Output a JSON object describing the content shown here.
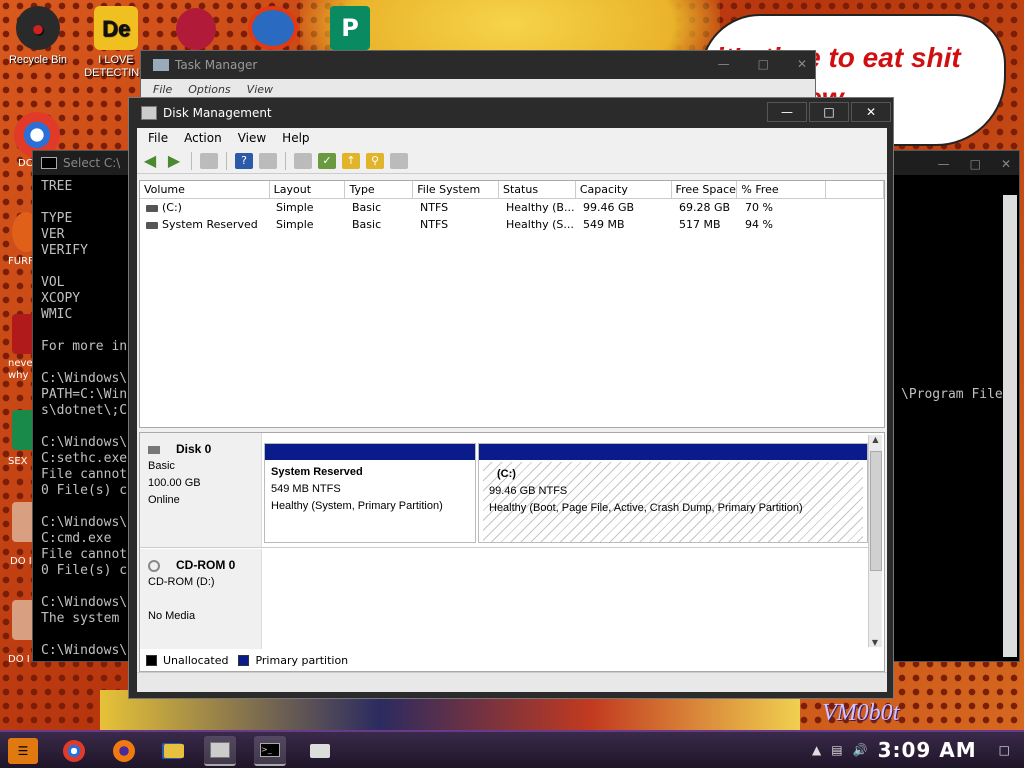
{
  "wallpaper": {
    "speech_bubble": "it's time to eat shit and chew",
    "tag": "VM0b0t"
  },
  "desktop": {
    "icons": [
      {
        "label": "Recycle Bin"
      },
      {
        "label": "I LOVE DETECTING"
      }
    ],
    "side_labels": [
      "DC",
      "FURF",
      "neve why",
      "SEX",
      "DO I",
      "DO I"
    ]
  },
  "cmd_window": {
    "title": "Select C:\\",
    "lines": [
      "TREE",
      "",
      "TYPE",
      "VER",
      "VERIFY",
      "",
      "VOL",
      "XCOPY",
      "WMIC",
      "",
      "For more in",
      "",
      "C:\\Windows\\",
      "PATH=C:\\Win",
      "s\\dotnet\\;C",
      "",
      "C:\\Windows\\",
      "C:sethc.exe",
      "File cannot",
      "0 File(s) c",
      "",
      "C:\\Windows\\",
      "C:cmd.exe",
      "File cannot",
      "0 File(s) c",
      "",
      "C:\\Windows\\",
      "The system",
      "",
      "C:\\Windows\\"
    ],
    "right_text": "\\Program File"
  },
  "task_manager": {
    "title": "Task Manager",
    "menu": [
      "File",
      "Options",
      "View"
    ]
  },
  "disk_management": {
    "title": "Disk Management",
    "menu": [
      "File",
      "Action",
      "View",
      "Help"
    ],
    "columns": [
      "Volume",
      "Layout",
      "Type",
      "File System",
      "Status",
      "Capacity",
      "Free Space",
      "% Free",
      ""
    ],
    "volumes": [
      {
        "volume": "(C:)",
        "layout": "Simple",
        "type": "Basic",
        "fs": "NTFS",
        "status": "Healthy (B...",
        "capacity": "99.46 GB",
        "free": "69.28 GB",
        "pct": "70 %"
      },
      {
        "volume": "System Reserved",
        "layout": "Simple",
        "type": "Basic",
        "fs": "NTFS",
        "status": "Healthy (S...",
        "capacity": "549 MB",
        "free": "517 MB",
        "pct": "94 %"
      }
    ],
    "disk0": {
      "name": "Disk 0",
      "type": "Basic",
      "size": "100.00 GB",
      "state": "Online",
      "partitions": [
        {
          "name": "System Reserved",
          "size": "549 MB NTFS",
          "status": "Healthy (System, Primary Partition)"
        },
        {
          "name": "(C:)",
          "size": "99.46 GB NTFS",
          "status": "Healthy (Boot, Page File, Active, Crash Dump, Primary Partition)"
        }
      ]
    },
    "cdrom0": {
      "name": "CD-ROM 0",
      "drive": "CD-ROM (D:)",
      "media": "No Media"
    },
    "legend": {
      "unallocated": "Unallocated",
      "primary": "Primary partition"
    },
    "colors": {
      "primary_band": "#0a1c8c",
      "unallocated": "#000000"
    }
  },
  "taskbar": {
    "clock": "3:09 AM",
    "apps": [
      "start",
      "chrome",
      "firefox",
      "media-player",
      "file-explorer",
      "disk-management",
      "cmd",
      "usb-drive"
    ]
  }
}
